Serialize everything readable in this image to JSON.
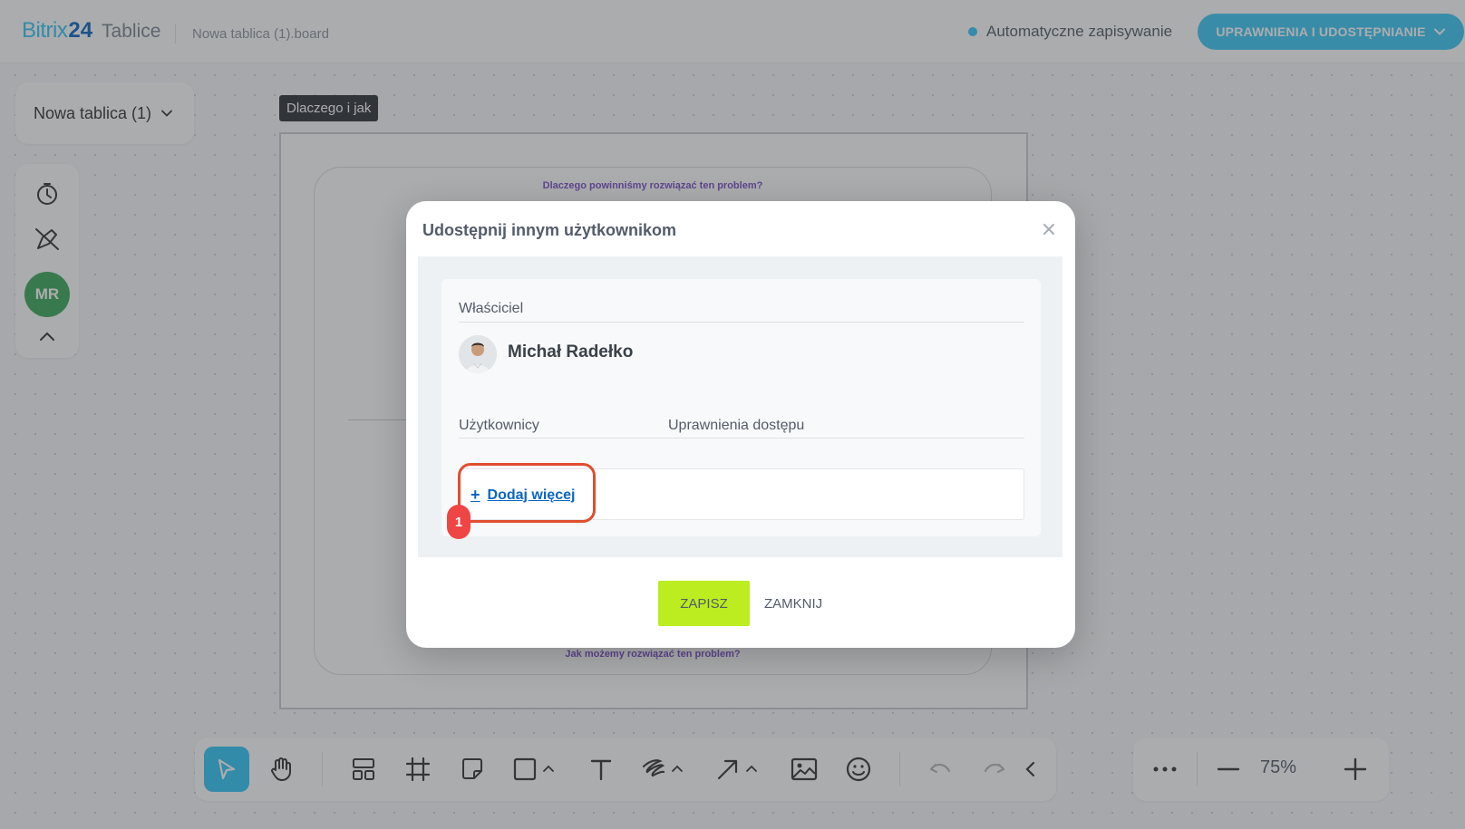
{
  "header": {
    "logo_bitrix": "Bitrix",
    "logo_24": "24",
    "logo_product": "Tablice",
    "file_name": "Nowa tablica (1).board",
    "autosave_label": "Automatyczne zapisywanie",
    "share_button_label": "UPRAWNIENIA I UDOSTĘPNIANIE"
  },
  "board_selector": {
    "label": "Nowa tablica (1)"
  },
  "left_toolbar": {
    "icons": [
      "timer-icon",
      "pen-off-icon",
      "avatar",
      "chevron-up-icon"
    ],
    "avatar_initials": "MR"
  },
  "canvas": {
    "frame_label": "Dlaczego i jak",
    "question_top": "Dlaczego powinniśmy rozwiązać ten problem?",
    "question_bottom": "Jak możemy rozwiązać ten problem?"
  },
  "bottom_toolbar": {
    "tools": [
      "select-icon",
      "hand-icon",
      "layout-icon",
      "frame-icon",
      "sticky-note-icon",
      "shape-icon",
      "text-icon",
      "pen-icon",
      "arrow-icon",
      "image-icon",
      "emoji-icon",
      "undo-icon",
      "redo-icon",
      "collapse-icon"
    ]
  },
  "zoom": {
    "value": "75%"
  },
  "modal": {
    "title": "Udostępnij innym użytkownikom",
    "owner_heading": "Właściciel",
    "owner_name": "Michał Radełko",
    "users_heading": "Użytkownicy",
    "access_heading": "Uprawnienia dostępu",
    "add_more_label": "Dodaj więcej",
    "save_button": "ZAPISZ",
    "close_button": "ZAMKNIJ"
  },
  "annotation": {
    "badge_number": "1"
  },
  "colors": {
    "accent": "#2fc6f6",
    "brand_blue": "#0b66c3",
    "save_green": "#bbed21",
    "highlight_red": "#e04e2e",
    "avatar_green": "#3aaa5b"
  }
}
